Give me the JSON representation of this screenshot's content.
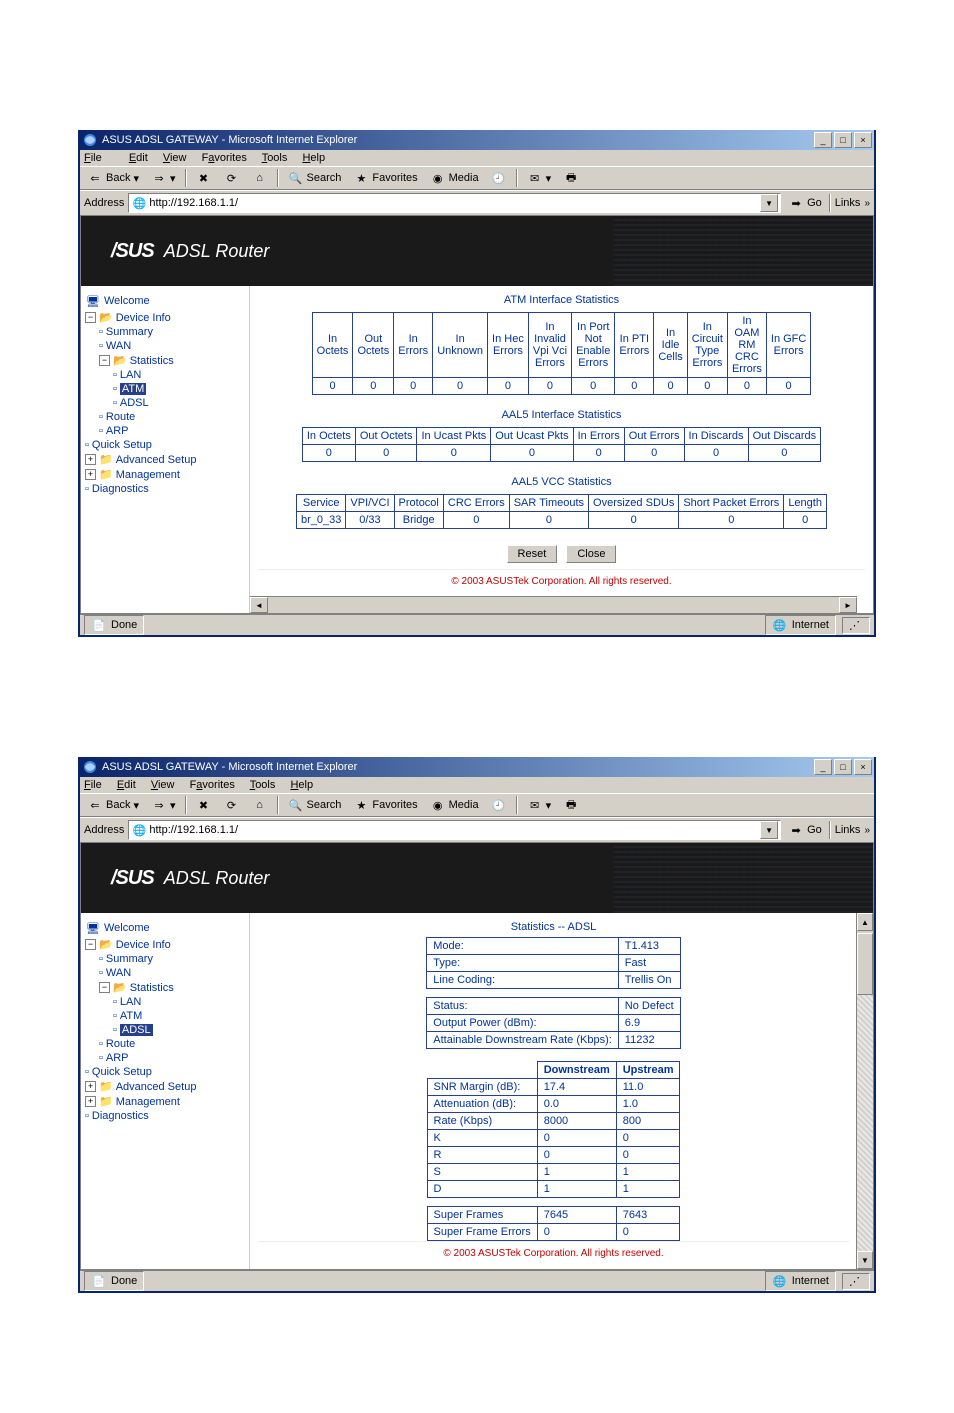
{
  "window_title": "ASUS ADSL GATEWAY - Microsoft Internet Explorer",
  "menubar": {
    "file": "File",
    "edit": "Edit",
    "view": "View",
    "favorites": "Favorites",
    "tools": "Tools",
    "help": "Help"
  },
  "toolbar": {
    "back": "Back",
    "search": "Search",
    "favorites": "Favorites",
    "media": "Media"
  },
  "addressbar": {
    "label": "Address",
    "url": "http://192.168.1.1/",
    "go": "Go",
    "links": "Links"
  },
  "banner": {
    "brand": "/SUS",
    "product": "ADSL Router"
  },
  "tree_common": {
    "welcome": "Welcome",
    "device_info": "Device Info",
    "summary": "Summary",
    "wan": "WAN",
    "statistics": "Statistics",
    "lan": "LAN",
    "atm": "ATM",
    "adsl": "ADSL",
    "route": "Route",
    "arp": "ARP",
    "quick_setup": "Quick Setup",
    "advanced_setup": "Advanced Setup",
    "management": "Management",
    "diagnostics": "Diagnostics"
  },
  "copyright": "© 2003 ASUSTek Corporation. All rights reserved.",
  "statusbar": {
    "done": "Done",
    "zone": "Internet"
  },
  "shot1": {
    "captions": {
      "atm": "ATM Interface Statistics",
      "aal5": "AAL5 Interface Statistics",
      "vcc": "AAL5 VCC Statistics"
    },
    "atm_headers": [
      "In\nOctets",
      "Out\nOctets",
      "In\nErrors",
      "In\nUnknown",
      "In Hec\nErrors",
      "In\nInvalid\nVpi Vci\nErrors",
      "In Port\nNot\nEnable\nErrors",
      "In PTI\nErrors",
      "In\nIdle\nCells",
      "In\nCircuit\nType\nErrors",
      "In\nOAM\nRM\nCRC\nErrors",
      "In GFC\nErrors"
    ],
    "atm_values": [
      "0",
      "0",
      "0",
      "0",
      "0",
      "0",
      "0",
      "0",
      "0",
      "0",
      "0",
      "0"
    ],
    "aal5_headers": [
      "In Octets",
      "Out Octets",
      "In Ucast Pkts",
      "Out Ucast Pkts",
      "In Errors",
      "Out Errors",
      "In Discards",
      "Out Discards"
    ],
    "aal5_values": [
      "0",
      "0",
      "0",
      "0",
      "0",
      "0",
      "0",
      "0"
    ],
    "vcc_headers": [
      "Service",
      "VPI/VCI",
      "Protocol",
      "CRC Errors",
      "SAR Timeouts",
      "Oversized SDUs",
      "Short Packet Errors",
      "Length"
    ],
    "vcc_row": [
      "br_0_33",
      "0/33",
      "Bridge",
      "0",
      "0",
      "0",
      "0",
      "0"
    ],
    "buttons": {
      "reset": "Reset",
      "close": "Close"
    }
  },
  "shot2": {
    "caption": "Statistics -- ADSL",
    "rows1": [
      {
        "label": "Mode:",
        "value": "T1.413"
      },
      {
        "label": "Type:",
        "value": "Fast"
      },
      {
        "label": "Line Coding:",
        "value": "Trellis On"
      }
    ],
    "rows2": [
      {
        "label": "Status:",
        "value": "No Defect"
      },
      {
        "label": "Output Power (dBm):",
        "value": "6.9"
      },
      {
        "label": "Attainable Downstream Rate (Kbps):",
        "value": "11232"
      }
    ],
    "cols": {
      "down": "Downstream",
      "up": "Upstream"
    },
    "metrics": [
      {
        "label": "SNR Margin (dB):",
        "down": "17.4",
        "up": "11.0"
      },
      {
        "label": "Attenuation (dB):",
        "down": "0.0",
        "up": "1.0"
      },
      {
        "label": "Rate (Kbps)",
        "down": "8000",
        "up": "800"
      },
      {
        "label": "K",
        "down": "0",
        "up": "0"
      },
      {
        "label": "R",
        "down": "0",
        "up": "0"
      },
      {
        "label": "S",
        "down": "1",
        "up": "1"
      },
      {
        "label": "D",
        "down": "1",
        "up": "1"
      }
    ],
    "frames": [
      {
        "label": "Super Frames",
        "down": "7645",
        "up": "7643"
      },
      {
        "label": "Super Frame Errors",
        "down": "0",
        "up": "0"
      }
    ]
  }
}
